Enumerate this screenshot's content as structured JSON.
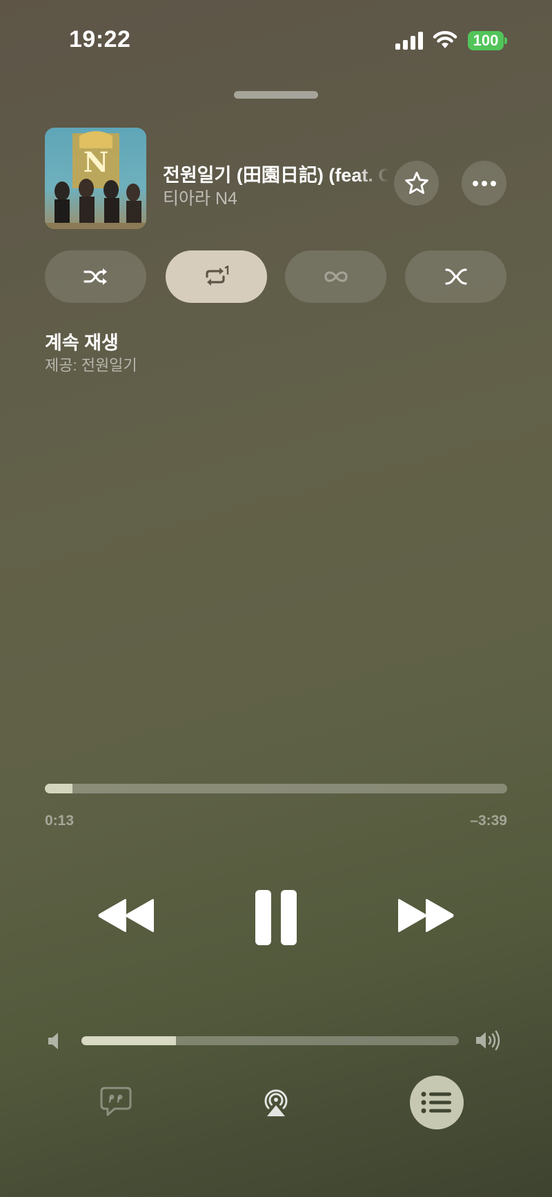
{
  "status_bar": {
    "time": "19:22",
    "battery": "100"
  },
  "now_playing": {
    "title": "전원일기 (田園日記) (feat. Coogie)",
    "artist": "티아라 N4"
  },
  "up_next": {
    "heading": "계속 재생",
    "subtitle": "제공: 전원일기"
  },
  "playback": {
    "elapsed": "0:13",
    "remaining": "–3:39",
    "progress": 0.06,
    "volume": 0.25
  },
  "colors": {
    "accent_button": "#d7cdbd",
    "battery": "#52c45a"
  },
  "icons": {
    "favorite": "star-icon",
    "more": "more-icon",
    "shuffle": "shuffle-icon",
    "repeat": "repeat-one-icon",
    "autoplay": "infinity-icon",
    "crossfade": "crossfade-icon",
    "lyrics": "lyrics-icon",
    "airplay": "airplay-icon",
    "queue": "queue-icon"
  }
}
